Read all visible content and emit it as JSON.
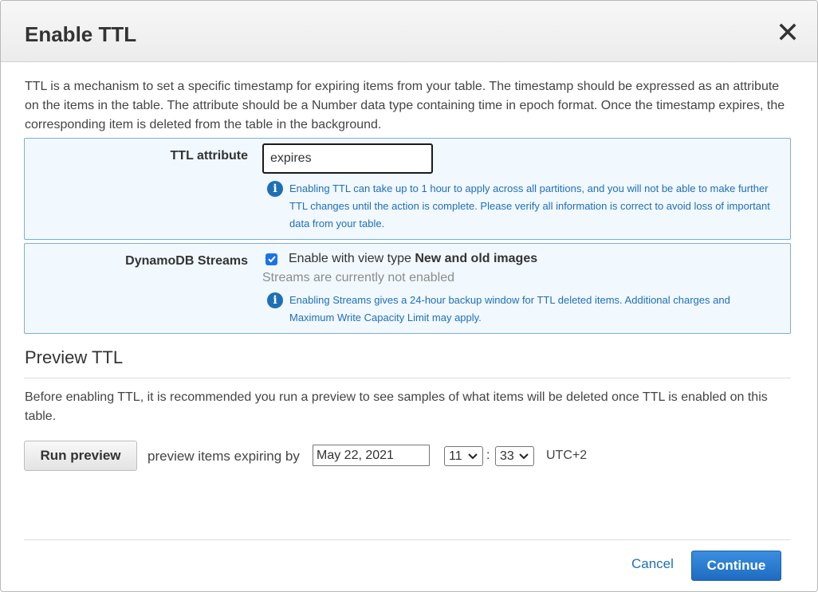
{
  "dialog": {
    "title": "Enable TTL",
    "description": "TTL is a mechanism to set a specific timestamp for expiring items from your table. The timestamp should be expressed as an attribute on the items in the table. The attribute should be a Number data type containing time in epoch format. Once the timestamp expires, the corresponding item is deleted from the table in the background."
  },
  "ttl_attribute": {
    "label": "TTL attribute",
    "value": "expires",
    "info": "Enabling TTL can take up to 1 hour to apply across all partitions, and you will not be able to make further TTL changes until the action is complete. Please verify all information is correct to avoid loss of important data from your table."
  },
  "streams": {
    "label": "DynamoDB Streams",
    "checkbox_prefix": "Enable with view type ",
    "checkbox_view_type": "New and old images",
    "checked": true,
    "status": "Streams are currently not enabled",
    "info": "Enabling Streams gives a 24-hour backup window for TTL deleted items. Additional charges and Maximum Write Capacity Limit may apply."
  },
  "preview": {
    "title": "Preview TTL",
    "description": "Before enabling TTL, it is recommended you run a preview to see samples of what items will be deleted once TTL is enabled on this table.",
    "run_button": "Run preview",
    "expiring_label": "preview items expiring by",
    "date": "May 22, 2021",
    "hour": "11",
    "minute": "33",
    "separator": ":",
    "timezone": "UTC+2"
  },
  "footer": {
    "cancel": "Cancel",
    "continue": "Continue"
  },
  "colors": {
    "accent": "#1f6fb5",
    "panel_bg": "#f1f8fe",
    "panel_border": "#7faed4",
    "primary_button": "#1e6cc1"
  },
  "icons": {
    "close": "close-icon",
    "info": "info-icon",
    "checkbox": "checkmark-icon",
    "select": "chevron-down-icon"
  }
}
